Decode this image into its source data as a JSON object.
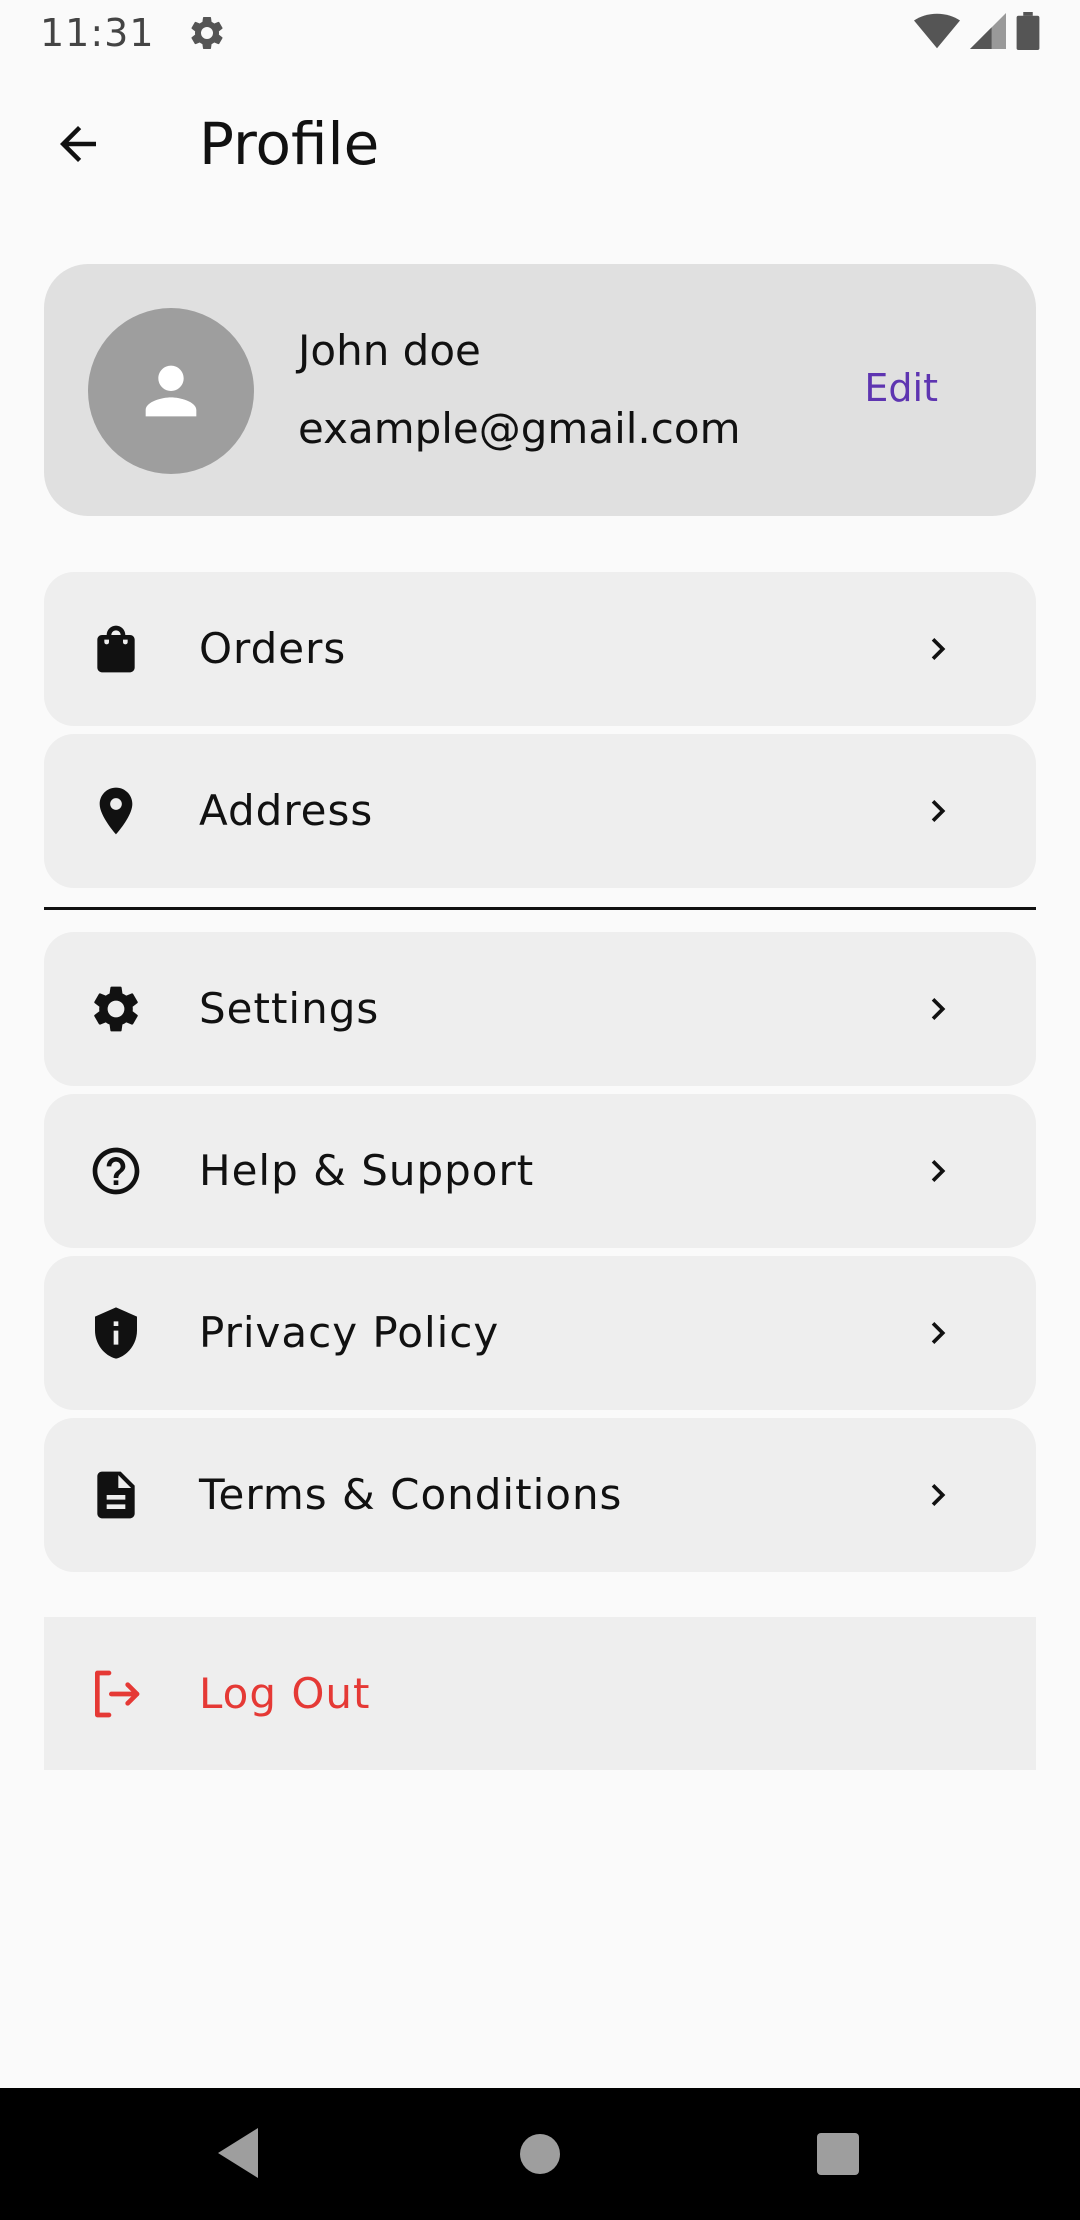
{
  "status_bar": {
    "time": "11:31"
  },
  "app_bar": {
    "title": "Profile"
  },
  "profile": {
    "name": "John doe",
    "email": "example@gmail.com",
    "edit_label": "Edit"
  },
  "menu": {
    "orders": "Orders",
    "address": "Address",
    "settings": "Settings",
    "help": "Help & Support",
    "privacy": "Privacy Policy",
    "terms": "Terms & Conditions",
    "logout": "Log Out"
  },
  "colors": {
    "accent": "#5e35b1",
    "danger": "#e53935",
    "card": "#e0e0e0",
    "item": "#eeeeee"
  }
}
